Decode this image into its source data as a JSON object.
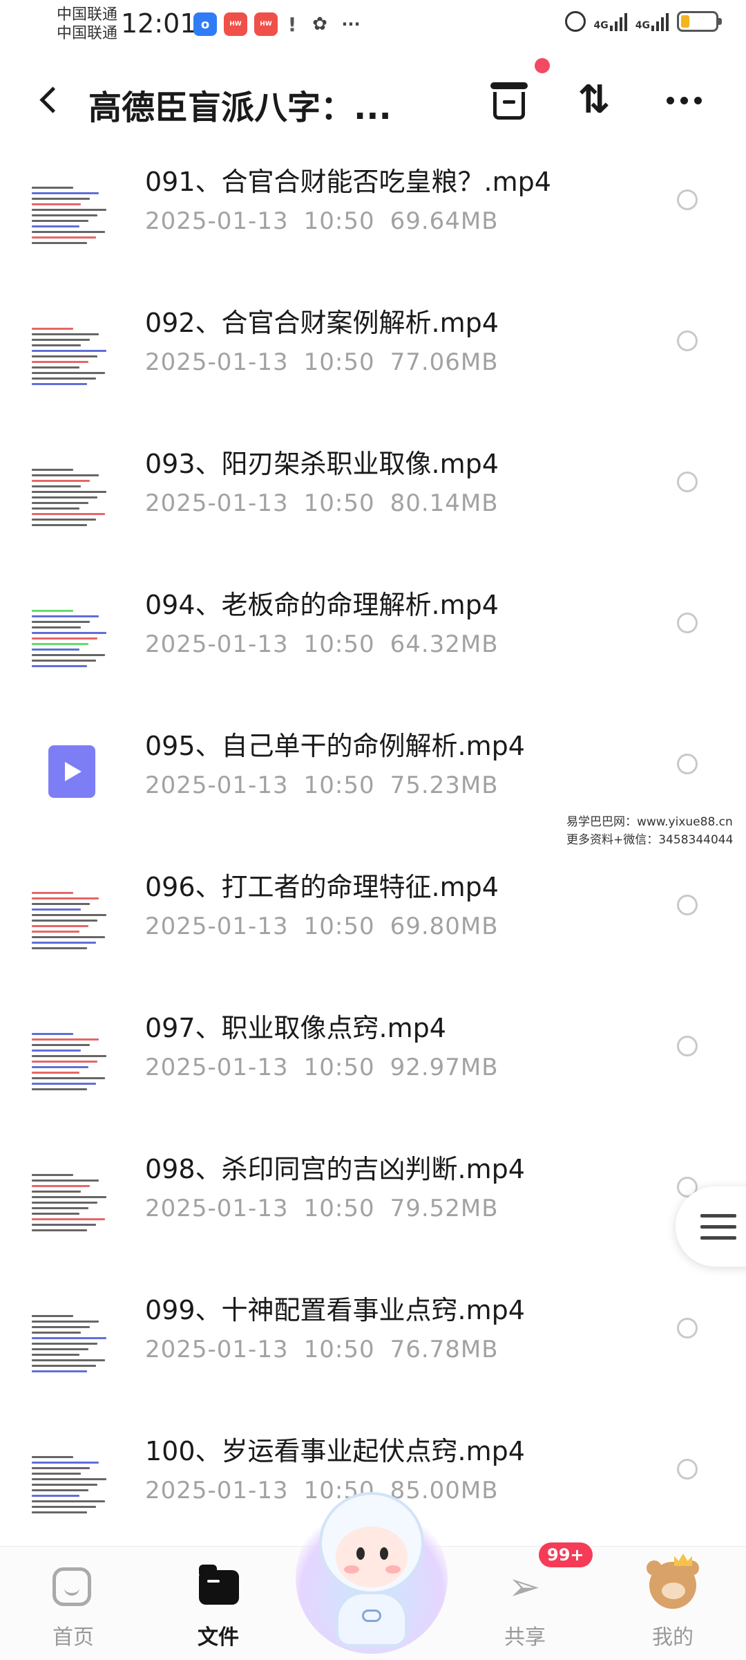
{
  "status_bar": {
    "carrier_1": "中国联通",
    "carrier_2": "中国联通",
    "time": "12:01",
    "network_1": "4G",
    "network_2": "4G",
    "battery_level_percent": 25
  },
  "header": {
    "title": "高德臣盲派八字：...",
    "back_icon": "back-arrow-icon",
    "archive_icon": "archive-box-icon",
    "sort_icon": "sort-icon",
    "more_icon": "more-dots-icon"
  },
  "files": [
    {
      "name": "091、合官合财能否吃皇粮？.mp4",
      "date": "2025-01-13",
      "time": "10:50",
      "size": "69.64MB",
      "thumb": "doc"
    },
    {
      "name": "092、合官合财案例解析.mp4",
      "date": "2025-01-13",
      "time": "10:50",
      "size": "77.06MB",
      "thumb": "doc"
    },
    {
      "name": "093、阳刃架杀职业取像.mp4",
      "date": "2025-01-13",
      "time": "10:50",
      "size": "80.14MB",
      "thumb": "doc"
    },
    {
      "name": "094、老板命的命理解析.mp4",
      "date": "2025-01-13",
      "time": "10:50",
      "size": "64.32MB",
      "thumb": "doc"
    },
    {
      "name": "095、自己单干的命例解析.mp4",
      "date": "2025-01-13",
      "time": "10:50",
      "size": "75.23MB",
      "thumb": "video"
    },
    {
      "name": "096、打工者的命理特征.mp4",
      "date": "2025-01-13",
      "time": "10:50",
      "size": "69.80MB",
      "thumb": "doc"
    },
    {
      "name": "097、职业取像点窍.mp4",
      "date": "2025-01-13",
      "time": "10:50",
      "size": "92.97MB",
      "thumb": "doc"
    },
    {
      "name": "098、杀印同宫的吉凶判断.mp4",
      "date": "2025-01-13",
      "time": "10:50",
      "size": "79.52MB",
      "thumb": "doc"
    },
    {
      "name": "099、十神配置看事业点窍.mp4",
      "date": "2025-01-13",
      "time": "10:50",
      "size": "76.78MB",
      "thumb": "doc"
    },
    {
      "name": "100、岁运看事业起伏点窍.mp4",
      "date": "2025-01-13",
      "time": "10:50",
      "size": "85.00MB",
      "thumb": "doc"
    }
  ],
  "watermark": {
    "line1": "易学巴巴网：www.yixue88.cn",
    "line2": "更多资料+微信：3458344044"
  },
  "bottom_nav": {
    "home": "首页",
    "files": "文件",
    "share": "共享",
    "share_badge": "99+",
    "mine": "我的"
  },
  "colors": {
    "accent_red": "#f24a62",
    "badge_red": "#f53b57",
    "video_purple": "#7d7ef5",
    "meta_gray": "#a2a2a2"
  }
}
